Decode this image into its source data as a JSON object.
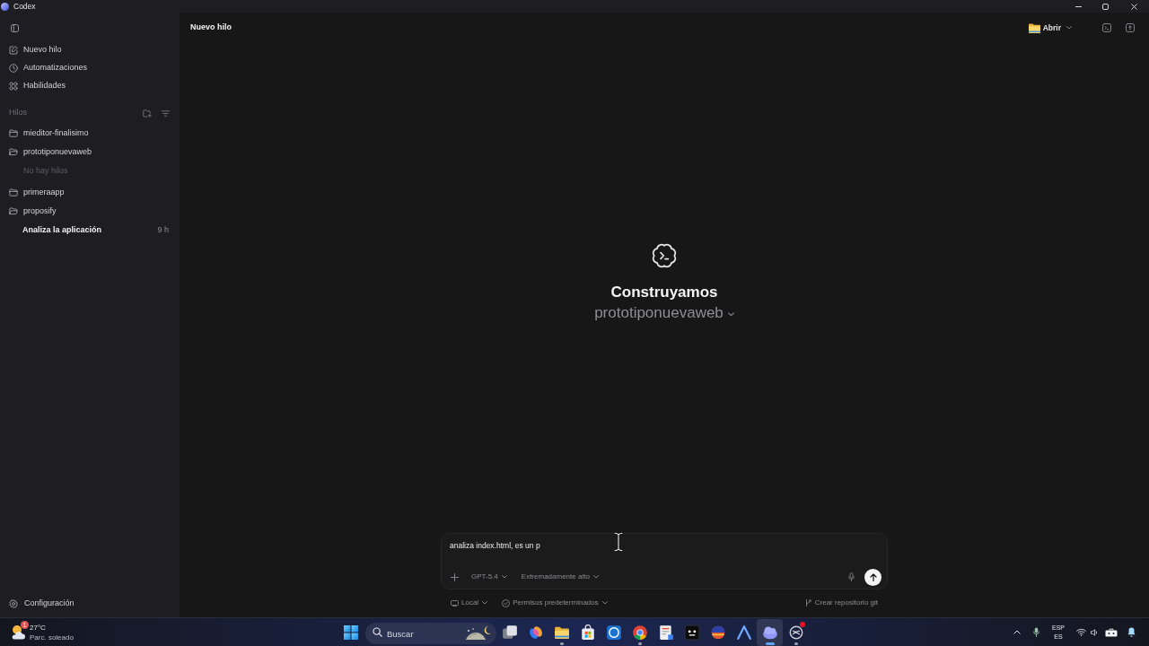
{
  "window": {
    "title": "Codex"
  },
  "sidebar": {
    "nav": [
      {
        "label": "Nuevo hilo"
      },
      {
        "label": "Automatizaciones"
      },
      {
        "label": "Habilidades"
      }
    ],
    "threads_section": {
      "title": "Hilos"
    },
    "projects": [
      {
        "name": "mieditor-finalisimo",
        "expanded": false
      },
      {
        "name": "prototiponuevaweb",
        "expanded": true,
        "children": [
          {
            "kind": "empty",
            "label": "No hay hilos"
          }
        ]
      },
      {
        "name": "primeraapp",
        "expanded": false
      },
      {
        "name": "proposify",
        "expanded": true,
        "children": [
          {
            "kind": "thread",
            "title": "Analiza la aplicación",
            "time": "9 h"
          }
        ]
      }
    ],
    "settings": {
      "label": "Configuración"
    }
  },
  "header": {
    "title": "Nuevo hilo",
    "open_button": {
      "label": "Abrir"
    }
  },
  "hero": {
    "title": "Construyamos",
    "project": "prototiponuevaweb"
  },
  "composer": {
    "value": "analiza index.html, es un p",
    "model": "GPT-5.4",
    "reasoning": "Extremadamente alto"
  },
  "composer_footer": {
    "environment": "Local",
    "permissions": "Permisos predeterminados",
    "git_action": "Crear repositorio git"
  },
  "taskbar": {
    "weather": {
      "badge": "1",
      "temperature": "27°C",
      "condition": "Parc. soleado"
    },
    "search": {
      "placeholder": "Buscar"
    },
    "apps": [
      {
        "running": false,
        "selected": false,
        "notification": false
      },
      {
        "running": false,
        "selected": false,
        "notification": false
      },
      {
        "running": true,
        "selected": false,
        "notification": false
      },
      {
        "running": false,
        "selected": false,
        "notification": false
      },
      {
        "running": false,
        "selected": false,
        "notification": false
      },
      {
        "running": true,
        "selected": false,
        "notification": false
      },
      {
        "running": false,
        "selected": false,
        "notification": false
      },
      {
        "running": false,
        "selected": false,
        "notification": false
      },
      {
        "running": false,
        "selected": false,
        "notification": false
      },
      {
        "running": false,
        "selected": false,
        "notification": false
      },
      {
        "running": true,
        "selected": true,
        "notification": false
      },
      {
        "running": true,
        "selected": false,
        "notification": true
      }
    ],
    "tray": {
      "language": "ESP",
      "layout": "ES"
    }
  }
}
